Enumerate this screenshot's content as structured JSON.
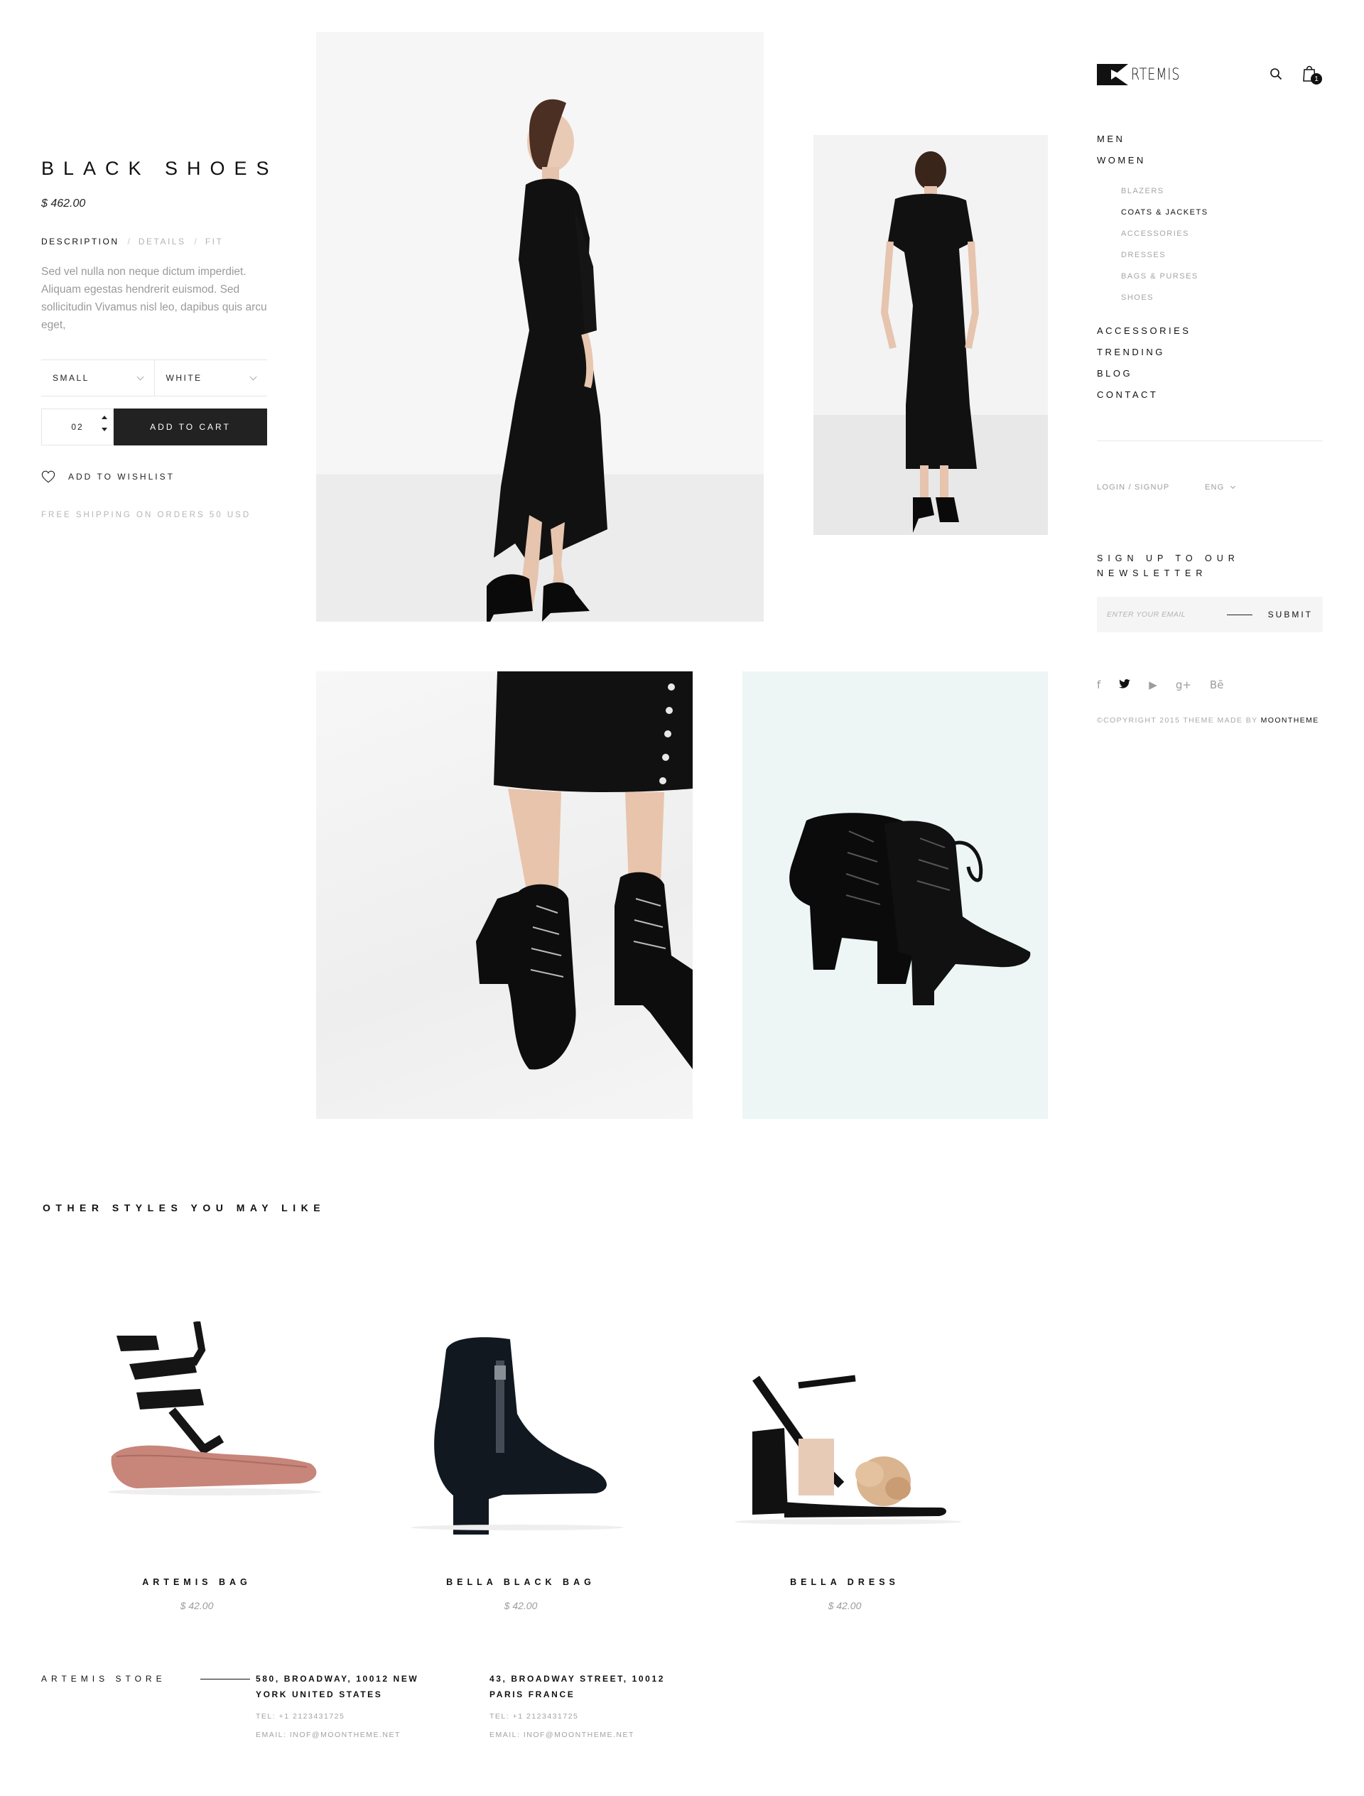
{
  "product": {
    "title": "BLACK SHOES",
    "price": "$ 462.00",
    "tabs": [
      {
        "label": "DESCRIPTION"
      },
      {
        "label": "DETAILS"
      },
      {
        "label": "FIT"
      }
    ],
    "tab_separator": "/",
    "description": "Sed vel nulla non neque dictum imperdiet. Aliquam egestas hendrerit euismod. Sed sollicitudin Vivamus nisl leo, dapibus quis arcu eget,",
    "size_value": "SMALL",
    "color_value": "WHITE",
    "quantity": "02",
    "add_to_cart_label": "ADD TO CART",
    "wishlist_label": "ADD TO WISHLIST",
    "shipping_note": "FREE SHIPPING ON ORDERS 50 USD"
  },
  "header": {
    "logo_text": "RTEMIS",
    "cart_count": "1"
  },
  "nav": {
    "top_items": [
      {
        "label": "MEN"
      },
      {
        "label": "WOMEN"
      }
    ],
    "women_sub_items": [
      {
        "label": "BLAZERS"
      },
      {
        "label": "COATS & JACKETS"
      },
      {
        "label": "ACCESSORIES"
      },
      {
        "label": "DRESSES"
      },
      {
        "label": "BAGS & PURSES"
      },
      {
        "label": "SHOES"
      }
    ],
    "lower_items": [
      {
        "label": "ACCESSORIES"
      },
      {
        "label": "TRENDING"
      },
      {
        "label": "BLOG"
      },
      {
        "label": "CONTACT"
      }
    ]
  },
  "account": {
    "login_label": "LOGIN / SIGNUP",
    "language": "ENG"
  },
  "newsletter": {
    "title": "SIGN UP TO OUR NEWSLETTER",
    "placeholder": "ENTER YOUR EMAIL",
    "submit_label": "SUBMIT"
  },
  "social": {
    "icons": [
      {
        "name": "facebook-icon",
        "glyph": "f"
      },
      {
        "name": "twitter-icon",
        "glyph": "🐦"
      },
      {
        "name": "youtube-icon",
        "glyph": "▶"
      },
      {
        "name": "google-plus-icon",
        "glyph": "g+"
      },
      {
        "name": "behance-icon",
        "glyph": "Bē"
      }
    ]
  },
  "copyright": {
    "text": "©COPYRIGHT 2015 THEME MADE BY",
    "brand": "MOONTHEME"
  },
  "related": {
    "title": "OTHER STYLES YOU MAY LIKE",
    "items": [
      {
        "name": "ARTEMIS BAG",
        "price": "$ 42.00"
      },
      {
        "name": "BELLA BLACK BAG",
        "price": "$ 42.00"
      },
      {
        "name": "BELLA DRESS",
        "price": "$ 42.00"
      }
    ]
  },
  "footer": {
    "store_label": "ARTEMIS STORE",
    "addresses": [
      {
        "address": "580, BROADWAY, 10012 NEW YORK UNITED STATES",
        "tel": "TEL:  +1 2123431725",
        "email": "EMAIL:  INOF@MOONTHEME.NET"
      },
      {
        "address": "43, BROADWAY STREET, 10012 PARIS FRANCE",
        "tel": "TEL:  +1 2123431725",
        "email": "EMAIL:  INOF@MOONTHEME.NET"
      }
    ]
  },
  "colors": {
    "text_dark": "#111111",
    "muted": "#9a9a9a",
    "button_bg": "#222222",
    "newsletter_bg": "#f5f5f5",
    "shoe_photo_bg": "#eef5f5"
  }
}
